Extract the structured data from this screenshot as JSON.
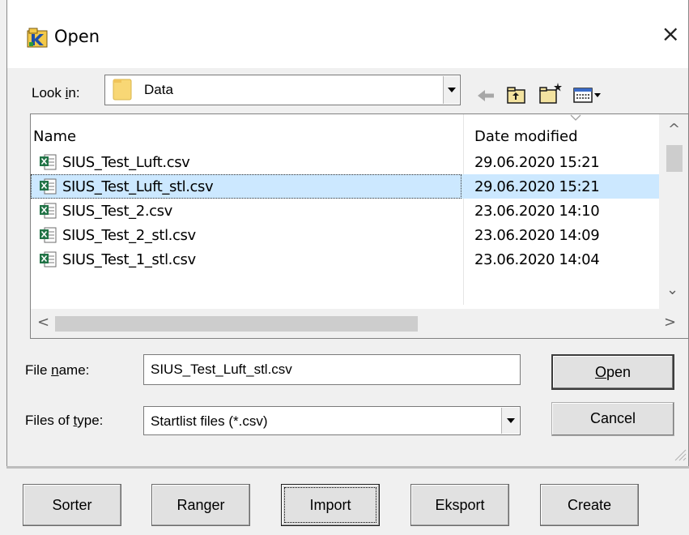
{
  "dialog": {
    "title": "Open",
    "close_glyph": "×",
    "look_in": {
      "label_pre": "Look ",
      "label_u": "i",
      "label_post": "n:",
      "value": "Data"
    },
    "file_list": {
      "columns": {
        "name": "Name",
        "date": "Date modified"
      },
      "rows": [
        {
          "name": "SIUS_Test_Luft.csv",
          "date": "29.06.2020 15:21",
          "selected": false
        },
        {
          "name": "SIUS_Test_Luft_stl.csv",
          "date": "29.06.2020 15:21",
          "selected": true
        },
        {
          "name": "SIUS_Test_2.csv",
          "date": "23.06.2020 14:10",
          "selected": false
        },
        {
          "name": "SIUS_Test_2_stl.csv",
          "date": "23.06.2020 14:09",
          "selected": false
        },
        {
          "name": "SIUS_Test_1_stl.csv",
          "date": "23.06.2020 14:04",
          "selected": false
        }
      ]
    },
    "file_name": {
      "label_pre": "File ",
      "label_u": "n",
      "label_post": "ame:",
      "value": "SIUS_Test_Luft_stl.csv"
    },
    "file_type": {
      "label_pre": "Files of ",
      "label_u": "t",
      "label_post": "ype:",
      "value": "Startlist files (*.csv)"
    },
    "buttons": {
      "open_u": "O",
      "open_rest": "pen",
      "cancel": "Cancel"
    },
    "scroll_glyphs": {
      "up": "^",
      "down": "⌄",
      "left": "<",
      "right": ">"
    }
  },
  "toolbar_icons": [
    "back-arrow-icon",
    "up-folder-icon",
    "new-folder-icon",
    "view-menu-icon"
  ],
  "app_buttons": [
    {
      "label": "Sorter",
      "focused": false
    },
    {
      "label": "Ranger",
      "focused": false
    },
    {
      "label": "Import",
      "focused": true
    },
    {
      "label": "Eksport",
      "focused": false
    },
    {
      "label": "Create",
      "focused": false
    }
  ],
  "colors": {
    "selection": "#cce8ff",
    "folder": "#f8d775",
    "excel_green": "#217346"
  }
}
